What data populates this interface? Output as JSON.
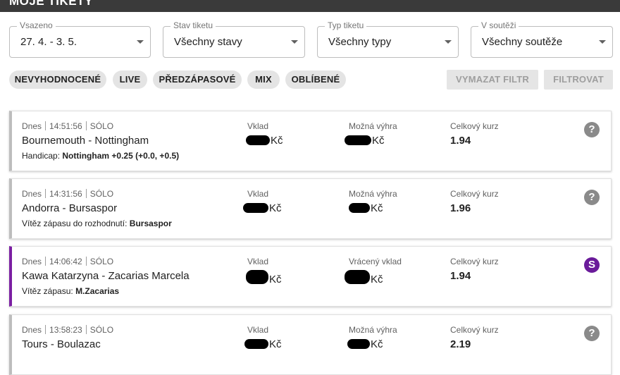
{
  "header": {
    "title": "MOJE TIKETY"
  },
  "filters": [
    {
      "label": "Vsazeno",
      "value": "27. 4. - 3. 5."
    },
    {
      "label": "Stav tiketu",
      "value": "Všechny stavy"
    },
    {
      "label": "Typ tiketu",
      "value": "Všechny typy"
    },
    {
      "label": "V soutěži",
      "value": "Všechny soutěže"
    }
  ],
  "chips": [
    "NEVYHODNOCENÉ",
    "LIVE",
    "PŘEDZÁPASOVÉ",
    "MIX",
    "OBLÍBENÉ"
  ],
  "buttons": {
    "clear": "VYMAZAT FILTR",
    "filter": "FILTROVAT"
  },
  "tickets": [
    {
      "day": "Dnes",
      "time": "14:51:56",
      "type": "SÓLO",
      "match": "Bournemouth - Nottingham",
      "bet_label": "Handicap:",
      "bet_value": "Nottingham +0.25 (+0.0, +0.5)",
      "stake_label": "Vklad",
      "stake_currency": "Kč",
      "win_label": "Možná výhra",
      "win_currency": "Kč",
      "odds_label": "Celkový kurz",
      "odds": "1.94",
      "status_icon": "question-icon",
      "status_glyph": "?"
    },
    {
      "day": "Dnes",
      "time": "14:31:56",
      "type": "SÓLO",
      "match": "Andorra - Bursaspor",
      "bet_label": "Vítěz zápasu do rozhodnutí:",
      "bet_value": "Bursaspor",
      "stake_label": "Vklad",
      "stake_currency": "Kč",
      "win_label": "Možná výhra",
      "win_currency": "Kč",
      "odds_label": "Celkový kurz",
      "odds": "1.96",
      "status_icon": "question-icon",
      "status_glyph": "?"
    },
    {
      "day": "Dnes",
      "time": "14:06:42",
      "type": "SÓLO",
      "match": "Kawa Katarzyna - Zacarias Marcela",
      "bet_label": "Vítěz zápasu:",
      "bet_value": "M.Zacarias",
      "stake_label": "Vklad",
      "stake_currency": "Kč",
      "win_label": "Vrácený vklad",
      "win_currency": "Kč",
      "odds_label": "Celkový kurz",
      "odds": "1.94",
      "status_icon": "storno-icon",
      "status_glyph": "S"
    },
    {
      "day": "Dnes",
      "time": "13:58:23",
      "type": "SÓLO",
      "match": "Tours - Boulazac",
      "bet_label": "",
      "bet_value": "",
      "stake_label": "Vklad",
      "stake_currency": "Kč",
      "win_label": "Možná výhra",
      "win_currency": "Kč",
      "odds_label": "Celkový kurz",
      "odds": "2.19",
      "status_icon": "question-icon",
      "status_glyph": "?"
    }
  ],
  "colors": {
    "header_bg": "#3a3a3a",
    "accent_purple": "#7b1fa2",
    "chip_bg": "#e4e4e4"
  }
}
